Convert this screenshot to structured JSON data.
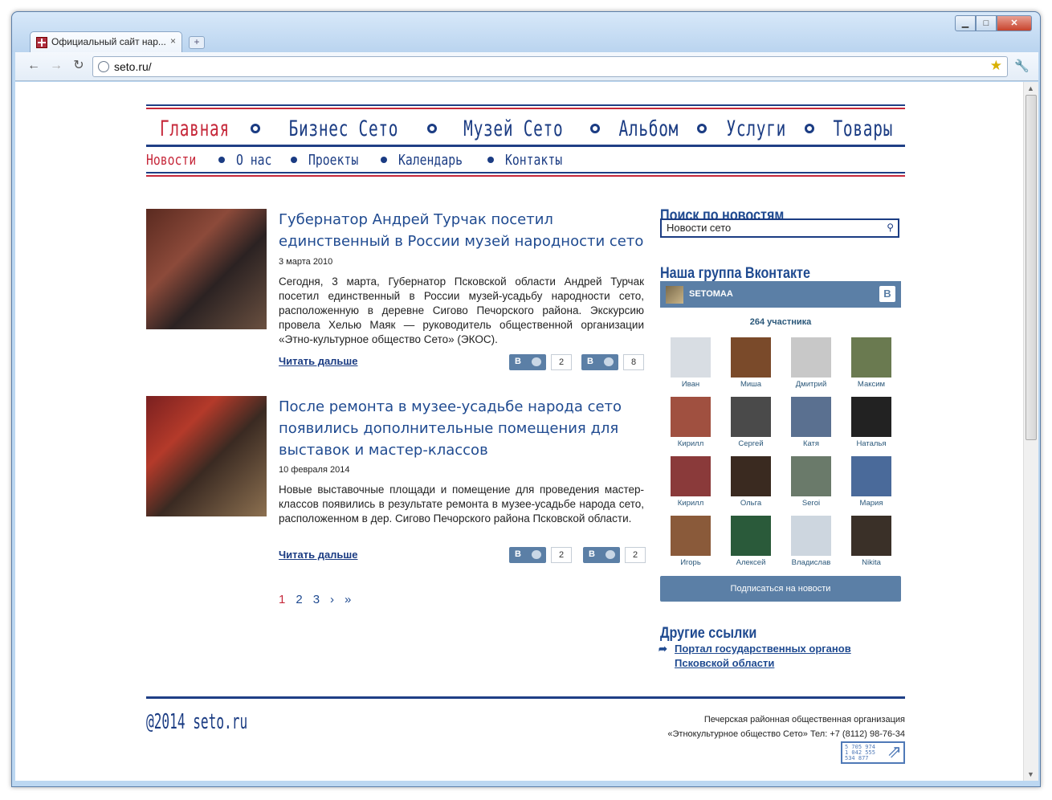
{
  "browser": {
    "tab_title": "Официальный сайт нар...",
    "tab_close": "×",
    "new_tab": "+",
    "url": "seto.ru/",
    "min": "▁",
    "max": "□",
    "close": "✕",
    "back": "←",
    "forward": "→",
    "reload": "↻",
    "star": "★",
    "wrench": "🔧"
  },
  "nav": {
    "main": [
      "Главная",
      "Бизнес Сето",
      "Музей Сето",
      "Альбом",
      "Услуги",
      "Товары"
    ],
    "sub": [
      "Новости",
      "О нас",
      "Проекты",
      "Календарь",
      "Контакты"
    ]
  },
  "articles": [
    {
      "title": "Губернатор Андрей Турчак посетил единственный в России музей народности сето",
      "date": "3 марта 2010",
      "text": "Сегодня, 3 марта, Губернатор Псковской области Андрей Турчак посетил единственный в России музей-усадьбу народности сето, расположенную в деревне Сигово Печорского района. Экскурсию провела Хелью Маяк — руководитель общественной организации «Этно-культурное общество Сето» (ЭКОС).",
      "more": "Читать дальше",
      "comments": "2",
      "likes": "8"
    },
    {
      "title": "После ремонта в музее-усадьбе народа сето появились дополнительные помещения для выставок и мастер-классов",
      "date": "10 февраля 2014",
      "text": "Новые выставочные площади и помещение для проведения мастер-классов появились в результате ремонта в музее-усадьбе народа сето, расположенном в дер. Сигово Печорского района Псковской области.",
      "more": "Читать дальше",
      "comments": "2",
      "likes": "2"
    }
  ],
  "vk_letter": "В",
  "pager": [
    "1",
    "2",
    "3",
    "›",
    "»"
  ],
  "sidebar": {
    "search_title": "Поиск по новостям",
    "search_value": "Новости сето",
    "vk_title": "Наша группа Вконтакте",
    "vk_group": "SETOMAA",
    "vk_count": "264 участника",
    "members": [
      "Иван",
      "Миша",
      "Дмитрий",
      "Максим",
      "Кирилл",
      "Сергей",
      "Катя",
      "Наталья",
      "Кирилл",
      "Ольга",
      "Seroi",
      "Мария",
      "Игорь",
      "Алексей",
      "Владислав",
      "Nikita"
    ],
    "subscribe": "Подписаться на новости",
    "links_title": "Другие ссылки",
    "link1": "Портал государственных органов",
    "link2": "Псковской области"
  },
  "footer": {
    "copy": "@2014 seto.ru",
    "org1": "Печерская районная общественная  организация",
    "org2": "«Этнокультурное общество Сето» Тел: +7 (8112) 98-76-34",
    "counter": "5 705 974\n1 042 555\n534 877"
  }
}
